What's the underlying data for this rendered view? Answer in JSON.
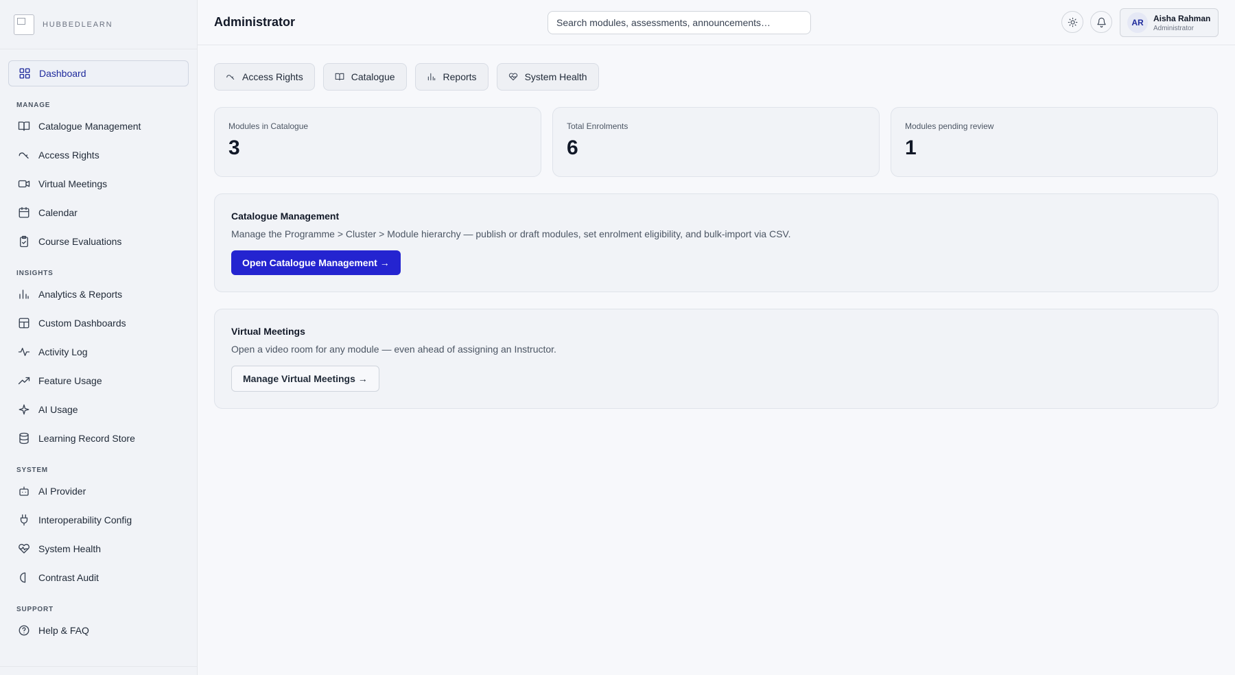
{
  "brand": {
    "name": "HUBBEDLEARN"
  },
  "sidebar": {
    "dashboard": {
      "label": "Dashboard",
      "icon": "grid-icon"
    },
    "sections": [
      {
        "title": "MANAGE",
        "items": [
          {
            "label": "Catalogue Management",
            "icon": "book-open-icon"
          },
          {
            "label": "Access Rights",
            "icon": "key-icon"
          },
          {
            "label": "Virtual Meetings",
            "icon": "video-icon"
          },
          {
            "label": "Calendar",
            "icon": "calendar-icon"
          },
          {
            "label": "Course Evaluations",
            "icon": "clipboard-check-icon"
          }
        ]
      },
      {
        "title": "INSIGHTS",
        "items": [
          {
            "label": "Analytics & Reports",
            "icon": "bar-chart-icon"
          },
          {
            "label": "Custom Dashboards",
            "icon": "layout-icon"
          },
          {
            "label": "Activity Log",
            "icon": "activity-icon"
          },
          {
            "label": "Feature Usage",
            "icon": "trending-up-icon"
          },
          {
            "label": "AI Usage",
            "icon": "sparkle-icon"
          },
          {
            "label": "Learning Record Store",
            "icon": "database-icon"
          }
        ]
      },
      {
        "title": "SYSTEM",
        "items": [
          {
            "label": "AI Provider",
            "icon": "bot-icon"
          },
          {
            "label": "Interoperability Config",
            "icon": "plug-icon"
          },
          {
            "label": "System Health",
            "icon": "heart-pulse-icon"
          },
          {
            "label": "Contrast Audit",
            "icon": "contrast-icon"
          }
        ]
      },
      {
        "title": "SUPPORT",
        "items": [
          {
            "label": "Help & FAQ",
            "icon": "help-circle-icon"
          }
        ]
      }
    ]
  },
  "header": {
    "title": "Administrator",
    "search_placeholder": "Search modules, assessments, announcements…",
    "user": {
      "initials": "AR",
      "name": "Aisha Rahman",
      "role": "Administrator"
    }
  },
  "quick_tabs": [
    {
      "label": "Access Rights",
      "icon": "key-icon"
    },
    {
      "label": "Catalogue",
      "icon": "book-open-icon"
    },
    {
      "label": "Reports",
      "icon": "bar-chart-icon"
    },
    {
      "label": "System Health",
      "icon": "heart-pulse-icon"
    }
  ],
  "stats": [
    {
      "label": "Modules in Catalogue",
      "value": "3"
    },
    {
      "label": "Total Enrolments",
      "value": "6"
    },
    {
      "label": "Modules pending review",
      "value": "1"
    }
  ],
  "cards": {
    "catalogue": {
      "title": "Catalogue Management",
      "description": "Manage the Programme > Cluster > Module hierarchy — publish or draft modules, set enrolment eligibility, and bulk-import via CSV.",
      "button": "Open Catalogue Management →"
    },
    "meetings": {
      "title": "Virtual Meetings",
      "description": "Open a video room for any module — even ahead of assigning an Instructor.",
      "button": "Manage Virtual Meetings →"
    }
  },
  "colors": {
    "accent": "#2424d0",
    "active_nav": "#1e2a9c"
  }
}
